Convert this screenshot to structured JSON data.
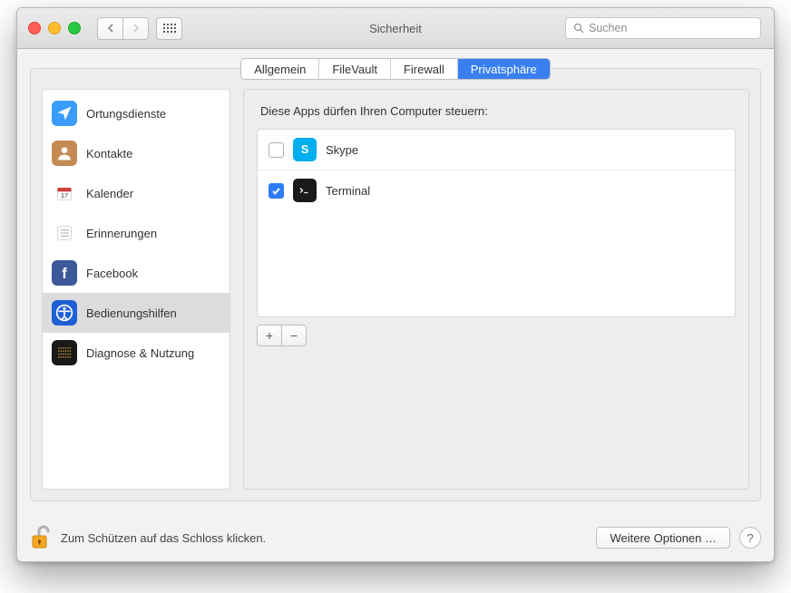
{
  "window": {
    "title": "Sicherheit",
    "search_placeholder": "Suchen"
  },
  "tabs": [
    {
      "label": "Allgemein",
      "active": false
    },
    {
      "label": "FileVault",
      "active": false
    },
    {
      "label": "Firewall",
      "active": false
    },
    {
      "label": "Privatsphäre",
      "active": true
    }
  ],
  "sidebar": {
    "items": [
      {
        "label": "Ortungsdienste",
        "icon": "location-icon",
        "selected": false,
        "bg": "#3a9cfb",
        "fg": "#fff"
      },
      {
        "label": "Kontakte",
        "icon": "contacts-icon",
        "selected": false,
        "bg": "#c58b55",
        "fg": "#fff"
      },
      {
        "label": "Kalender",
        "icon": "calendar-icon",
        "selected": false,
        "bg": "#ffffff",
        "fg": "#cc3b3b"
      },
      {
        "label": "Erinnerungen",
        "icon": "reminders-icon",
        "selected": false,
        "bg": "#ffffff",
        "fg": "#888"
      },
      {
        "label": "Facebook",
        "icon": "facebook-icon",
        "selected": false,
        "bg": "#3b5998",
        "fg": "#fff"
      },
      {
        "label": "Bedienungshilfen",
        "icon": "accessibility-icon",
        "selected": true,
        "bg": "#1f5fd6",
        "fg": "#fff"
      },
      {
        "label": "Diagnose & Nutzung",
        "icon": "diagnostics-icon",
        "selected": false,
        "bg": "#1a1a1a",
        "fg": "#e0a030"
      }
    ]
  },
  "main": {
    "heading": "Diese Apps dürfen Ihren Computer steuern:",
    "apps": [
      {
        "label": "Skype",
        "checked": false,
        "icon": "skype-icon",
        "bg": "#00aff0",
        "fg": "#fff"
      },
      {
        "label": "Terminal",
        "checked": true,
        "icon": "terminal-icon",
        "bg": "#1a1a1a",
        "fg": "#eee"
      }
    ],
    "plus": "+",
    "minus": "−"
  },
  "footer": {
    "lock_text": "Zum Schützen auf das Schloss klicken.",
    "more_options": "Weitere Optionen …",
    "help": "?"
  }
}
